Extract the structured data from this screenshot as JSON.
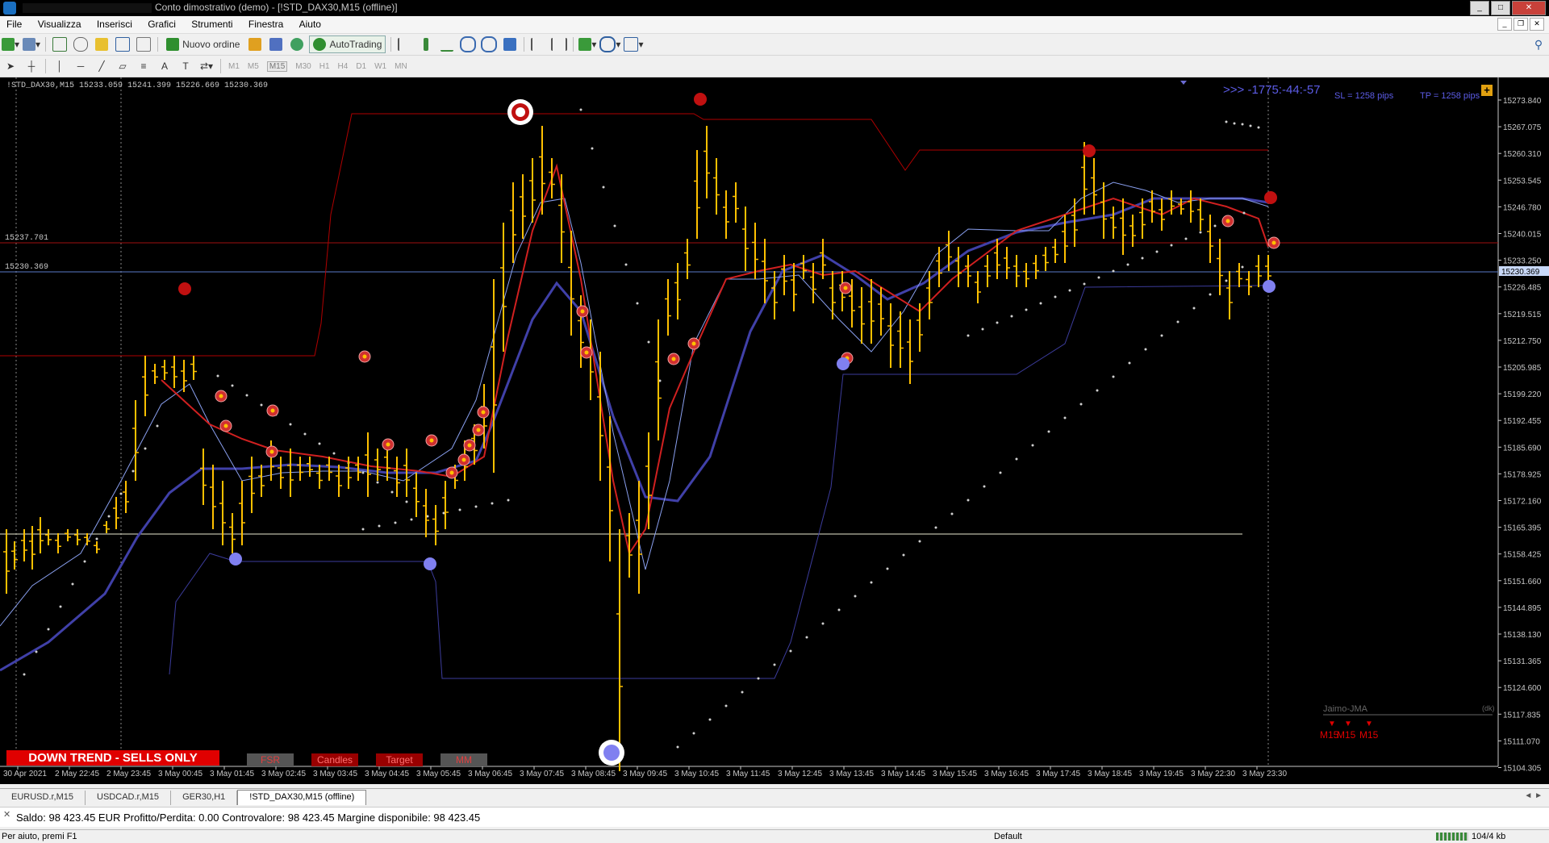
{
  "window": {
    "title": "Conto dimostrativo (demo) - [!STD_DAX30,M15 (offline)]"
  },
  "menu": [
    "File",
    "Visualizza",
    "Inserisci",
    "Grafici",
    "Strumenti",
    "Finestra",
    "Aiuto"
  ],
  "toolbar": {
    "new_order": "Nuovo ordine",
    "autotrading": "AutoTrading",
    "timeframes": [
      "M1",
      "M5",
      "M15",
      "M30",
      "H1",
      "H4",
      "D1",
      "W1",
      "MN"
    ],
    "active_timeframe": "M15"
  },
  "chart": {
    "symbol_info": "!STD_DAX30,M15  15233.059 15241.399 15226.669 15230.369",
    "countdown": ">>>  -1775:-44:-57",
    "sl_label": "SL = 1258 pips",
    "tp_label": "TP = 1258 pips",
    "plus_label": "+",
    "line_label_red": "15237.701",
    "line_label_blue": "15230.369",
    "current_price": "15230.369",
    "price_axis": [
      "15273.840",
      "15267.075",
      "15260.310",
      "15253.545",
      "15246.780",
      "15240.015",
      "15233.250",
      "15226.485",
      "15219.515",
      "15212.750",
      "15205.985",
      "15199.220",
      "15192.455",
      "15185.690",
      "15178.925",
      "15172.160",
      "15165.395",
      "15158.425",
      "15151.660",
      "15144.895",
      "15138.130",
      "15131.365",
      "15124.600",
      "15117.835",
      "15111.070",
      "15104.305"
    ],
    "time_axis": [
      "30 Apr 2021",
      "2 May 22:45",
      "2 May 23:45",
      "3 May 00:45",
      "3 May 01:45",
      "3 May 02:45",
      "3 May 03:45",
      "3 May 04:45",
      "3 May 05:45",
      "3 May 06:45",
      "3 May 07:45",
      "3 May 08:45",
      "3 May 09:45",
      "3 May 10:45",
      "3 May 11:45",
      "3 May 12:45",
      "3 May 13:45",
      "3 May 14:45",
      "3 May 15:45",
      "3 May 16:45",
      "3 May 17:45",
      "3 May 18:45",
      "3 May 19:45",
      "3 May 22:30",
      "3 May 23:30"
    ],
    "banner": "DOWN TREND - SELLS ONLY",
    "buttons": {
      "fsr": "FSR",
      "candles": "Candles",
      "target": "Target",
      "mm": "MM"
    },
    "indicator_name": "Jaimo-JMA",
    "indicator_tag": "(dk)",
    "mtf_labels": [
      "M15",
      "M15",
      "M15"
    ],
    "colors": {
      "background": "#000000",
      "bars": "#ffc000",
      "red_band": "#c00000",
      "blue_band": "#4a4aa8",
      "banner": "#e00000"
    }
  },
  "tabs": [
    "EURUSD.r,M15",
    "USDCAD.r,M15",
    "GER30,H1",
    "!STD_DAX30,M15 (offline)"
  ],
  "active_tab": "!STD_DAX30,M15 (offline)",
  "account": {
    "summary": "Saldo: 98 423.45 EUR  Profitto/Perdita: 0.00  Controvalore: 98 423.45  Margine disponibile: 98 423.45"
  },
  "status": {
    "help": "Per aiuto, premi F1",
    "profile": "Default",
    "traffic": "104/4 kb"
  }
}
